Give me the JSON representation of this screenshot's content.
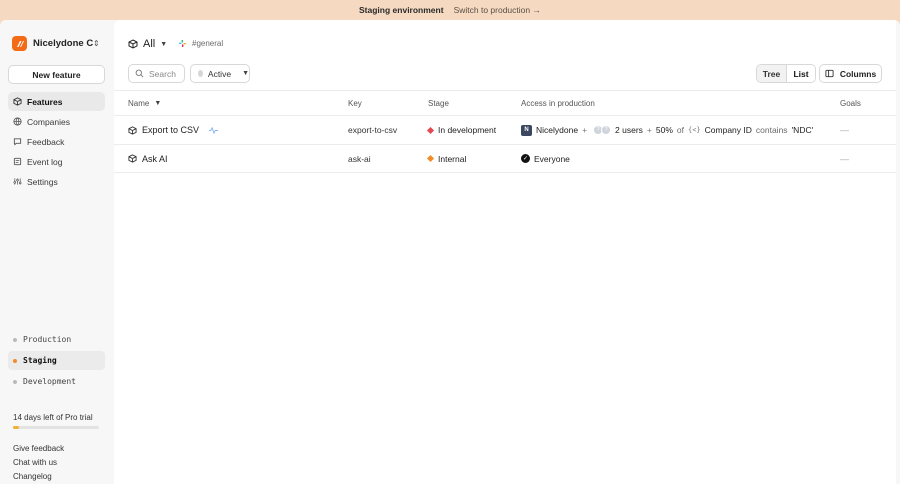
{
  "banner": {
    "environment": "Staging environment",
    "switch_label": "Switch to production →"
  },
  "sidebar": {
    "org_name": "Nicelydone Co",
    "new_feature": "New feature",
    "items": [
      {
        "label": "Features",
        "icon": "cube-icon",
        "active": true
      },
      {
        "label": "Companies",
        "icon": "globe-icon",
        "active": false
      },
      {
        "label": "Feedback",
        "icon": "chat-icon",
        "active": false
      },
      {
        "label": "Event log",
        "icon": "log-icon",
        "active": false
      },
      {
        "label": "Settings",
        "icon": "settings-icon",
        "active": false
      }
    ],
    "environments": [
      {
        "label": "Production",
        "active": false
      },
      {
        "label": "Staging",
        "active": true
      },
      {
        "label": "Development",
        "active": false
      }
    ],
    "trial_text": "14 days left of Pro trial",
    "trial_progress": 0.07,
    "links": [
      "Give feedback",
      "Chat with us",
      "Changelog"
    ]
  },
  "header": {
    "scope": "All",
    "channel": "#general"
  },
  "toolbar": {
    "search_placeholder": "Search",
    "filter_label": "Active",
    "view_tree": "Tree",
    "view_list": "List",
    "columns": "Columns"
  },
  "table": {
    "headers": {
      "name": "Name",
      "key": "Key",
      "stage": "Stage",
      "access": "Access in production",
      "goals": "Goals"
    },
    "rows": [
      {
        "name": "Export to CSV",
        "key": "export-to-csv",
        "stage": "In development",
        "stage_color": "#e5484d",
        "access": {
          "company": "Nicelydone",
          "company_initial": "N",
          "plus1": "+",
          "users": "2 users",
          "plus2": "+",
          "percent": "50%",
          "of": "of",
          "attr_code": "{<}",
          "attr": "Company ID",
          "op": "contains",
          "value": "'NDC'"
        },
        "goals": "—"
      },
      {
        "name": "Ask AI",
        "key": "ask-ai",
        "stage": "Internal",
        "stage_color": "#f28b2a",
        "access": {
          "everyone": "Everyone"
        },
        "goals": "—"
      }
    ]
  }
}
